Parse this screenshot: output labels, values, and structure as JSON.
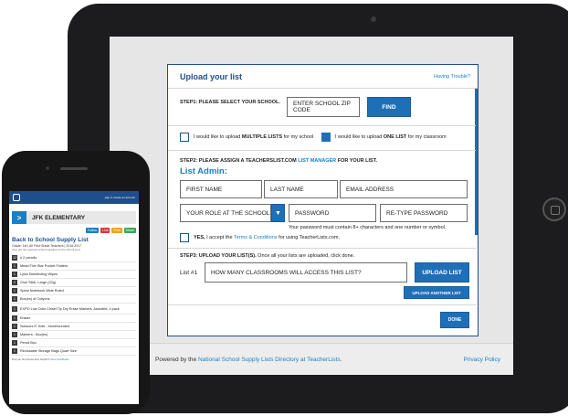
{
  "form": {
    "title": "Upload your list",
    "help_link": "Having Trouble?",
    "step1": {
      "label": "STEP1: PLEASE SELECT YOUR SCHOOL.",
      "zip_placeholder": "ENTER SCHOOL ZIP CODE",
      "find_label": "FIND"
    },
    "options": {
      "multiple_prefix": "I would like to upload ",
      "multiple_bold": "MULTIPLE LISTS",
      "multiple_suffix": " for my school",
      "one_prefix": "I would like to upload ",
      "one_bold": "ONE LIST",
      "one_suffix": " for my classroom"
    },
    "step2": {
      "label_prefix": "STEP2: PLEASE ASSIGN A TEACHERSLIST.COM ",
      "label_link": "LIST MANAGER",
      "label_suffix": " FOR YOUR LIST.",
      "list_admin": "List Admin:",
      "first_name": "FIRST NAME",
      "last_name": "LAST NAME",
      "email": "EMAIL ADDRESS",
      "role": "YOUR ROLE AT THE SCHOOL",
      "password": "PASSWORD",
      "retype_password": "RE-TYPE PASSWORD",
      "password_hint": "Your password must contain 8+ characters and one number or symbol.",
      "accept_bold": "YES,",
      "accept_text": " I accept the ",
      "terms_link": "Terms & Conditions",
      "accept_suffix": " for using TeacherLists.com."
    },
    "step3": {
      "label_bold": "STEP3: UPLOAD YOUR LIST(S).",
      "label_rest": " Once all your lists are uploaded, click done.",
      "list_label": "List #1",
      "classrooms_placeholder": "HOW MANY CLASSROOMS WILL ACCESS THIS LIST?",
      "upload_label": "UPLOAD LIST",
      "upload_another_label": "UPLOAD ANOTHER LIST",
      "done_label": "DONE"
    }
  },
  "footer": {
    "powered_prefix": "Powered by the ",
    "powered_link": "National School Supply Lists Directory at TeacherLists.",
    "privacy": "Privacy Policy"
  },
  "phone": {
    "top_links": "sign in   create an account",
    "school": "JFK ELEMENTARY",
    "share": [
      "Follow",
      "Link",
      "Print",
      "Share"
    ],
    "list_title": "Back to School Supply List",
    "list_sub": "Grade: 1st  |  All First Grade Teachers  |  2016-2017",
    "list_note": "here are the required school supplies for the school year.",
    "items": [
      {
        "qty": "12",
        "text": "# 2 pencils"
      },
      {
        "qty": "1",
        "text": "Mead Five Star Pocket Folders"
      },
      {
        "qty": "1",
        "text": "Lysol Disinfecting Wipes"
      },
      {
        "qty": "2",
        "text": "Glue Stick, Large (22g)"
      },
      {
        "qty": "1",
        "text": "Spiral Notebook Wide Ruled"
      },
      {
        "qty": "1",
        "text": "Box(es) of Crayons"
      },
      {
        "qty": "1",
        "text": "EXPO Low Odor Chisel Tip Dry Erase Markers, Assorted, 4 pack"
      },
      {
        "qty": "1",
        "text": "Eraser"
      },
      {
        "qty": "1",
        "text": "Scissors 5\" Kids - blunt/rounded"
      },
      {
        "qty": "1",
        "text": "Markers - Box(es)"
      },
      {
        "qty": "1",
        "text": "Pencil Box"
      },
      {
        "qty": "1",
        "text": "Reclosable Storage Bags Quart Size"
      }
    ],
    "foot": "Did you find these lists helpful?",
    "foot_link": "Give Feedback"
  },
  "colors": {
    "brand_blue": "#1f4e8c",
    "link_blue": "#1a7fc4",
    "button_blue": "#1f6fb8"
  }
}
